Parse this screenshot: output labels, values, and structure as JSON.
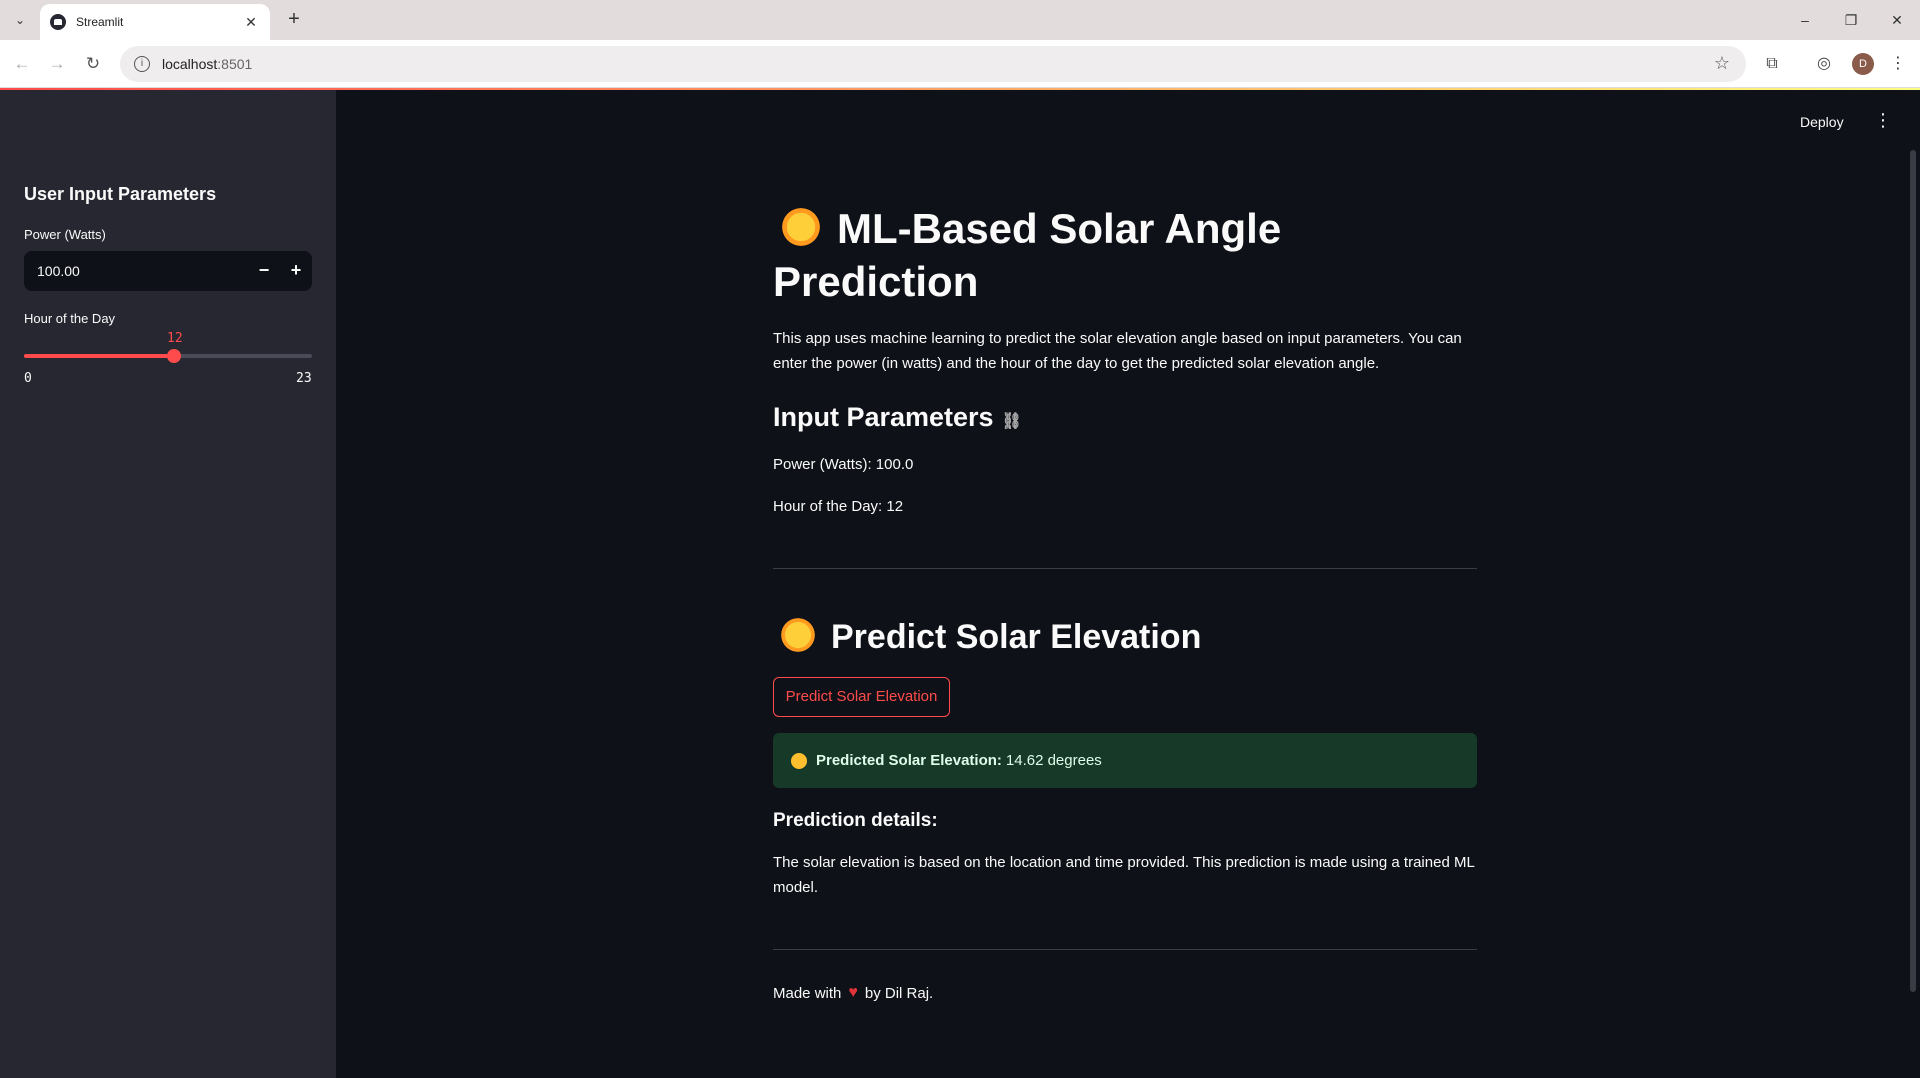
{
  "browser": {
    "tab_title": "Streamlit",
    "url_host": "localhost",
    "url_port": ":8501",
    "profile_initial": "D"
  },
  "sidebar": {
    "title": "User Input Parameters",
    "power_label": "Power (Watts)",
    "power_value": "100.00",
    "hour_label": "Hour of the Day",
    "hour_value": "12",
    "hour_min": "0",
    "hour_max": "23",
    "hour_fraction": 0.5217
  },
  "toolbar": {
    "deploy_label": "Deploy"
  },
  "main": {
    "title": "ML-Based Solar Angle Prediction",
    "intro": "This app uses machine learning to predict the solar elevation angle based on input parameters. You can enter the power (in watts) and the hour of the day to get the predicted solar elevation angle.",
    "input_header": "Input Parameters",
    "power_line": "Power (Watts): 100.0",
    "hour_line": "Hour of the Day: 12",
    "predict_header": "Predict Solar Elevation",
    "predict_button": "Predict Solar Elevation",
    "result_label": "Predicted Solar Elevation:",
    "result_value": "14.62 degrees",
    "details_header": "Prediction details:",
    "details_text": "The solar elevation is based on the location and time provided. This prediction is made using a trained ML model.",
    "footer_prefix": "Made with",
    "footer_suffix": "by Dil Raj."
  },
  "colors": {
    "primary": "#ff4b4b",
    "background": "#0e1117",
    "sidebar": "#262730",
    "success_bg": "#173928"
  },
  "icons": [
    "chevron-down-icon",
    "close-icon",
    "plus-icon",
    "back-icon",
    "forward-icon",
    "reload-icon",
    "info-icon",
    "star-icon",
    "extensions-icon",
    "sun-emoji-icon",
    "link-icon",
    "heart-icon",
    "kebab-icon"
  ]
}
